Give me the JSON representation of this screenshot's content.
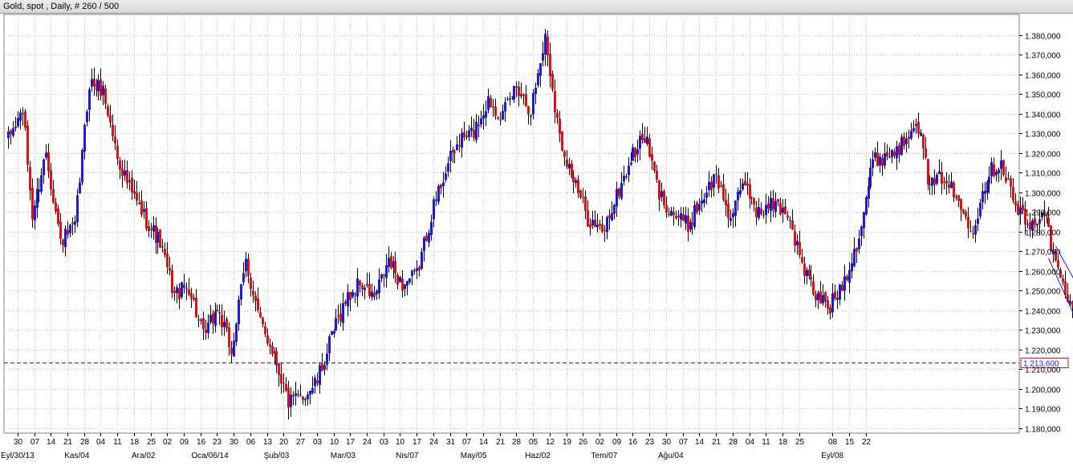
{
  "window": {
    "title": "Gold, spot , Daily, # 260 / 500"
  },
  "colors": {
    "up": "#1a1adc",
    "down": "#e01010",
    "wick": "#000000",
    "grid": "#bdbdbd",
    "price_line": "#1a1adc",
    "price_tag_border": "#e01010",
    "price_tag_text": "#1a1adc",
    "trend_channel": "#1a1adc"
  },
  "chart_data": {
    "type": "candlestick",
    "instrument": "Gold, spot",
    "timeframe": "Daily",
    "ylim": [
      1.1775,
      1.3905
    ],
    "y_ticks": [
      "1.180,000",
      "1.190,000",
      "1.200,000",
      "1.210,000",
      "1.220,000",
      "1.230,000",
      "1.240,000",
      "1.250,000",
      "1.260,000",
      "1.270,000",
      "1.280,000",
      "1.290,000",
      "1.300,000",
      "1.310,000",
      "1.320,000",
      "1.330,000",
      "1.340,000",
      "1.350,000",
      "1.360,000",
      "1.370,000",
      "1.380,000"
    ],
    "y_tick_values": [
      1.18,
      1.19,
      1.2,
      1.21,
      1.22,
      1.23,
      1.24,
      1.25,
      1.26,
      1.27,
      1.28,
      1.29,
      1.3,
      1.31,
      1.32,
      1.33,
      1.34,
      1.35,
      1.36,
      1.37,
      1.38
    ],
    "x_day_labels": [
      "30",
      "07",
      "14",
      "21",
      "28",
      "04",
      "11",
      "18",
      "25",
      "02",
      "09",
      "16",
      "23",
      "30",
      "06",
      "13",
      "20",
      "27",
      "03",
      "10",
      "17",
      "24",
      "03",
      "10",
      "17",
      "24",
      "31",
      "07",
      "14",
      "21",
      "28",
      "05",
      "12",
      "19",
      "26",
      "02",
      "09",
      "16",
      "23",
      "30",
      "07",
      "14",
      "21",
      "28",
      "04",
      "11",
      "18",
      "25",
      "08",
      "15",
      "22"
    ],
    "x_day_label_bar_index": [
      4,
      11,
      18,
      25,
      32,
      39,
      46,
      53,
      60,
      67,
      74,
      81,
      88,
      95,
      102,
      109,
      116,
      123,
      130,
      137,
      144,
      151,
      158,
      165,
      172,
      179,
      186,
      193,
      200,
      207,
      214,
      221,
      228,
      235,
      242,
      249,
      256,
      263,
      270,
      277,
      284,
      291,
      298,
      305,
      312,
      319,
      326,
      333,
      347,
      354,
      361
    ],
    "x_month_labels": [
      "Eyl/30/13",
      "Kas/04",
      "Ara/02",
      "Oca/06/14",
      "Şub/03",
      "Mar/03",
      "Nis/07",
      "May/05",
      "Haz/02",
      "Tem/07",
      "Ağu/04",
      "Eyl/08"
    ],
    "x_month_label_bar_index": [
      4,
      29,
      57,
      85,
      113,
      141,
      168,
      196,
      223,
      251,
      279,
      347
    ],
    "current_price": 1.2136,
    "current_price_label": "1.213,600",
    "close_path": [
      [
        0,
        1.327
      ],
      [
        6,
        1.342
      ],
      [
        10,
        1.288
      ],
      [
        16,
        1.321
      ],
      [
        22,
        1.275
      ],
      [
        28,
        1.282
      ],
      [
        34,
        1.356
      ],
      [
        40,
        1.352
      ],
      [
        46,
        1.318
      ],
      [
        52,
        1.299
      ],
      [
        58,
        1.286
      ],
      [
        64,
        1.274
      ],
      [
        70,
        1.248
      ],
      [
        76,
        1.252
      ],
      [
        82,
        1.226
      ],
      [
        88,
        1.241
      ],
      [
        94,
        1.219
      ],
      [
        100,
        1.265
      ],
      [
        106,
        1.233
      ],
      [
        112,
        1.218
      ],
      [
        118,
        1.193
      ],
      [
        124,
        1.196
      ],
      [
        130,
        1.204
      ],
      [
        136,
        1.226
      ],
      [
        142,
        1.245
      ],
      [
        148,
        1.254
      ],
      [
        154,
        1.246
      ],
      [
        160,
        1.265
      ],
      [
        166,
        1.253
      ],
      [
        172,
        1.258
      ],
      [
        178,
        1.289
      ],
      [
        184,
        1.312
      ],
      [
        190,
        1.326
      ],
      [
        196,
        1.331
      ],
      [
        202,
        1.347
      ],
      [
        208,
        1.339
      ],
      [
        214,
        1.355
      ],
      [
        220,
        1.342
      ],
      [
        226,
        1.379
      ],
      [
        232,
        1.328
      ],
      [
        238,
        1.306
      ],
      [
        244,
        1.287
      ],
      [
        250,
        1.279
      ],
      [
        256,
        1.298
      ],
      [
        262,
        1.317
      ],
      [
        268,
        1.329
      ],
      [
        274,
        1.299
      ],
      [
        280,
        1.289
      ],
      [
        286,
        1.283
      ],
      [
        292,
        1.297
      ],
      [
        298,
        1.308
      ],
      [
        304,
        1.287
      ],
      [
        310,
        1.305
      ],
      [
        316,
        1.289
      ],
      [
        322,
        1.294
      ],
      [
        328,
        1.29
      ],
      [
        334,
        1.263
      ],
      [
        340,
        1.247
      ],
      [
        346,
        1.242
      ],
      [
        352,
        1.256
      ],
      [
        358,
        1.278
      ],
      [
        364,
        1.316
      ],
      [
        370,
        1.319
      ],
      [
        376,
        1.324
      ],
      [
        382,
        1.339
      ],
      [
        388,
        1.302
      ],
      [
        394,
        1.309
      ],
      [
        400,
        1.294
      ],
      [
        406,
        1.282
      ],
      [
        412,
        1.309
      ],
      [
        418,
        1.316
      ],
      [
        424,
        1.293
      ],
      [
        430,
        1.281
      ],
      [
        436,
        1.292
      ],
      [
        440,
        1.267
      ],
      [
        446,
        1.245
      ],
      [
        452,
        1.227
      ],
      [
        456,
        1.213
      ]
    ],
    "trend_channel": {
      "upper": [
        [
          441,
          1.2727
        ],
        [
          471,
          1.2068
        ]
      ],
      "lower": [
        [
          438,
          1.2665
        ],
        [
          471,
          1.1778
        ]
      ]
    }
  }
}
